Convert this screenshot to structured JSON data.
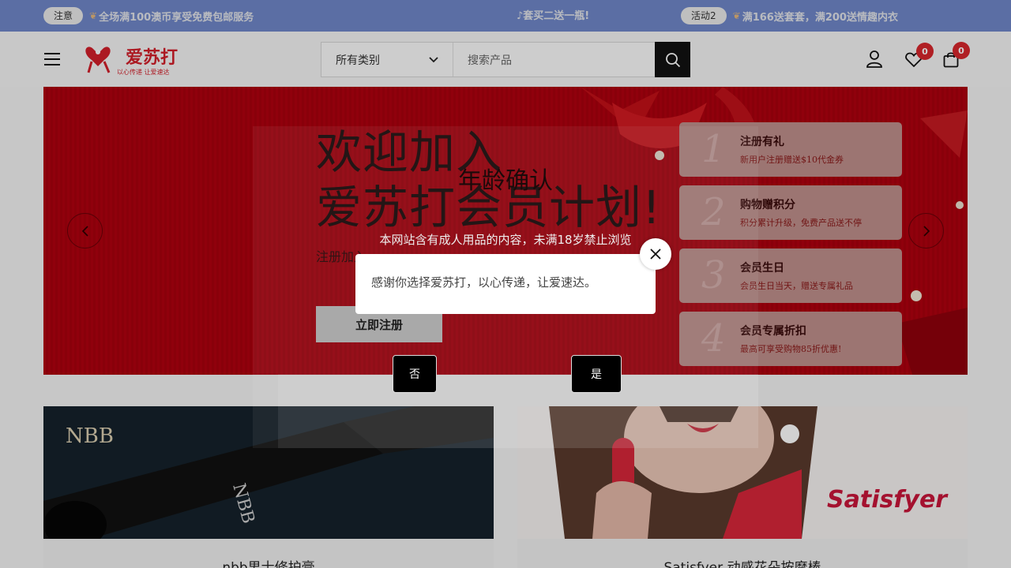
{
  "topbar": {
    "notice_label": "注意",
    "notice_text": "全场满100澳币享受免费包邮服务",
    "middle_text": "♪套买二送一瓶!",
    "activity_label": "活动2",
    "activity_text": "满166送套套，满200送情趣内衣"
  },
  "header": {
    "search_category": "所有类别",
    "search_placeholder": "搜索产品",
    "wishlist_count": "0",
    "cart_count": "0"
  },
  "banner": {
    "headline_1": "欢迎加入",
    "headline_2": "爱苏打会员计划!",
    "subline": "注册加入",
    "register_button": "立即注册",
    "cards": [
      {
        "num": "1",
        "title": "注册有礼",
        "desc": "新用户注册赠送$10代金券"
      },
      {
        "num": "2",
        "title": "购物赠积分",
        "desc": "积分累计升级，免费产品送不停"
      },
      {
        "num": "3",
        "title": "会员生日",
        "desc": "会员生日当天，赠送专属礼品"
      },
      {
        "num": "4",
        "title": "会员专属折扣",
        "desc": "最高可享受购物85折优惠!"
      }
    ]
  },
  "products": [
    {
      "name": "nbb男士修护膏",
      "img_brand": "NBB"
    },
    {
      "name": "Satisfyer 动感花朵按摩棒",
      "img_brand": "Satisfyer"
    }
  ],
  "modal": {
    "title": "年龄确认",
    "subtitle": "本网站含有成人用品的内容，未满18岁禁止浏览",
    "message": "感谢你选择爱苏打，以心传递，让爱速达。",
    "no_label": "否",
    "yes_label": "是"
  },
  "colors": {
    "topbar": "#6f87c9",
    "banner_red": "#b0000f",
    "badge": "#d7262c",
    "brand": "#d21f2a"
  }
}
